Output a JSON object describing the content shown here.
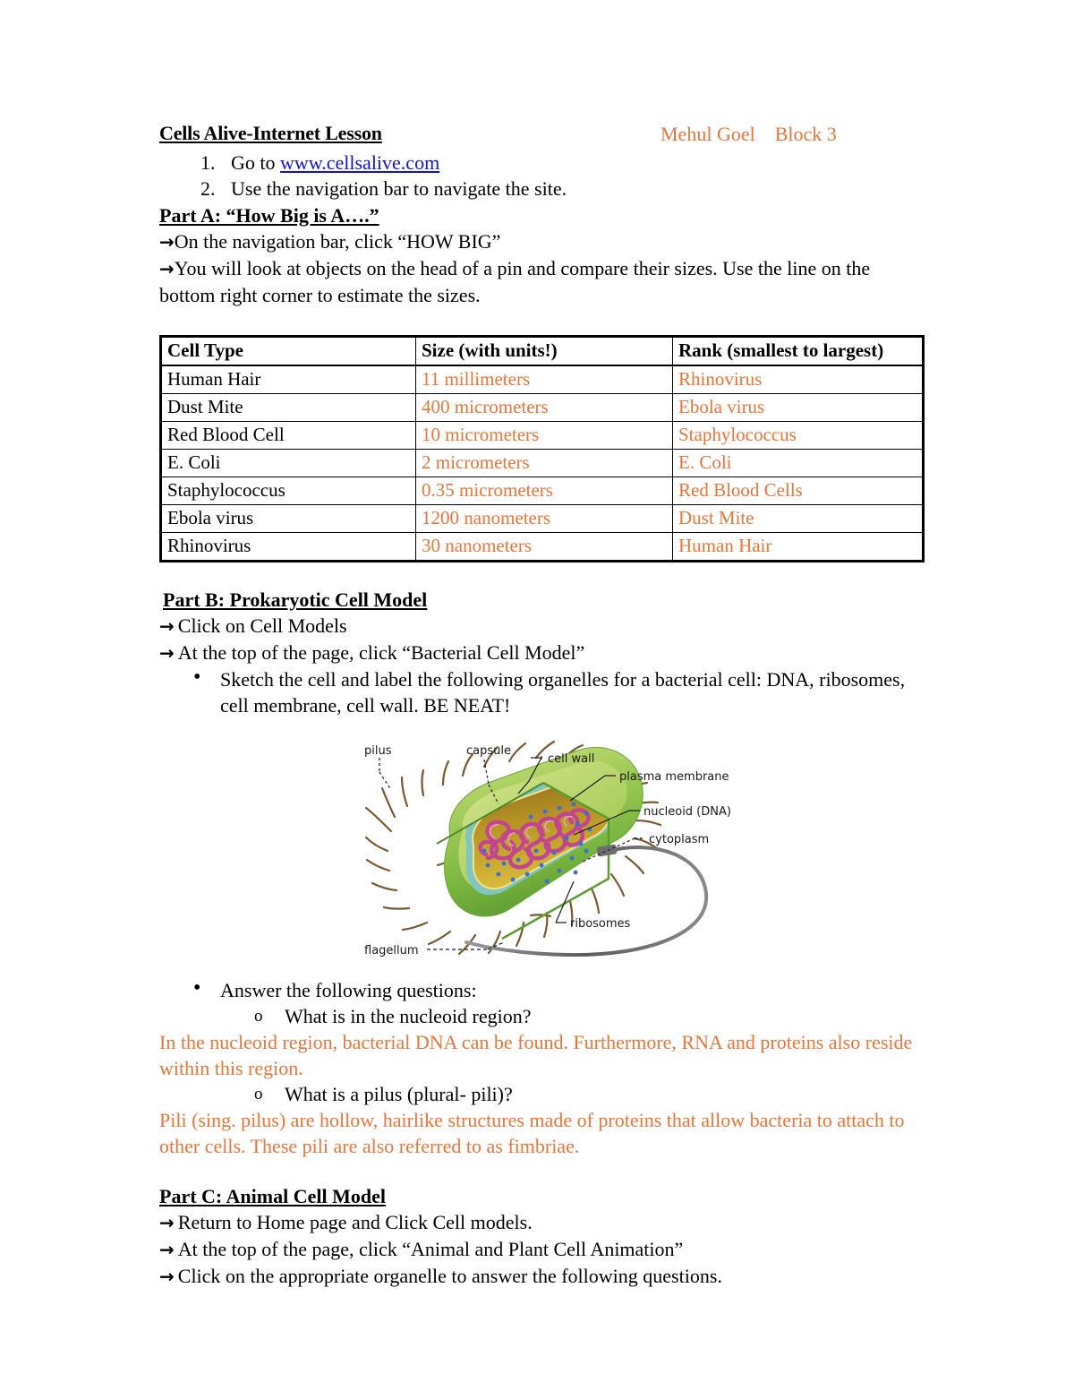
{
  "document": {
    "title": "Cells Alive-Internet Lesson",
    "student_name": "Mehul Goel",
    "block": "Block 3",
    "student_info": "Mehul Goel    Block 3"
  },
  "intro_steps": [
    {
      "number": "1.",
      "prefix": "Go to ",
      "link_text": "www.cellsalive.com"
    },
    {
      "number": "2.",
      "text": "Use the navigation bar to navigate the site."
    }
  ],
  "part_a": {
    "heading": "Part A: “How Big is A….”",
    "instructions": [
      "On the navigation bar, click “HOW BIG”",
      "You will look at objects on the head of a pin and compare their sizes.  Use the line on the bottom right corner to estimate the sizes."
    ],
    "table": {
      "headers": [
        "Cell Type",
        "Size (with units!)",
        "Rank (smallest to largest)"
      ],
      "rows": [
        {
          "cell_type": "Human Hair",
          "size": "11 millimeters",
          "rank": "Rhinovirus"
        },
        {
          "cell_type": "Dust Mite",
          "size": "400 micrometers",
          "rank": "Ebola virus"
        },
        {
          "cell_type": "Red Blood Cell",
          "size": "10 micrometers",
          "rank": "Staphylococcus"
        },
        {
          "cell_type": "E. Coli",
          "size": "2 micrometers",
          "rank": "E. Coli"
        },
        {
          "cell_type": "Staphylococcus",
          "size": "0.35 micrometers",
          "rank": "Red Blood Cells"
        },
        {
          "cell_type": "Ebola virus",
          "size": "1200 nanometers",
          "rank": "Dust Mite"
        },
        {
          "cell_type": "Rhinovirus",
          "size": "30 nanometers",
          "rank": "Human Hair"
        }
      ]
    }
  },
  "part_b": {
    "heading": "Part B: Prokaryotic Cell Model",
    "instructions": [
      "Click on Cell Models",
      "At the top of the page, click “Bacterial Cell Model”"
    ],
    "sketch_task": "Sketch the cell and label the following organelles for a bacterial cell: DNA, ribosomes, cell membrane, cell wall. BE NEAT!",
    "figure": {
      "labels": {
        "pilus": "pilus",
        "capsule": "capsule",
        "cell_wall": "cell wall",
        "plasma_membrane": "plasma membrane",
        "nucleoid": "nucleoid (DNA)",
        "cytoplasm": "cytoplasm",
        "ribosomes": "ribosomes",
        "flagellum": "flagellum"
      },
      "colors": {
        "capsule_green": "#8CC152",
        "capsule_light": "#C3D96B",
        "cell_wall_teal": "#7FC6BE",
        "cytoplasm_yellow": "#C9A227",
        "dna_magenta": "#C2458E",
        "ribosome_blue": "#3B6FD4",
        "flagellum_gray": "#6E6E6E",
        "pili_brown": "#7A5A2E"
      }
    },
    "answer_prompt": "Answer the following questions:",
    "questions": [
      {
        "question": "What is in the nucleoid region?",
        "answer": "In the nucleoid region, bacterial DNA can be found. Furthermore, RNA and proteins also reside within this region."
      },
      {
        "question": "What is a pilus (plural- pili)?",
        "answer": "Pili (sing. pilus) are hollow, hairlike structures made of proteins that allow bacteria to attach to other cells. These pili are also referred to as fimbriae."
      }
    ]
  },
  "part_c": {
    "heading": "Part C: Animal Cell Model",
    "instructions": [
      "Return to Home page and Click Cell models.",
      "At the top of the page, click “Animal and Plant Cell Animation”",
      "Click on the appropriate organelle to answer the following questions."
    ]
  },
  "colors": {
    "student_answer_orange": "#E8763A",
    "hyperlink_blue": "#1414CC",
    "text_black": "#000000"
  },
  "glyphs": {
    "arrow": "→",
    "bullet": "•",
    "sub_bullet": "o"
  }
}
